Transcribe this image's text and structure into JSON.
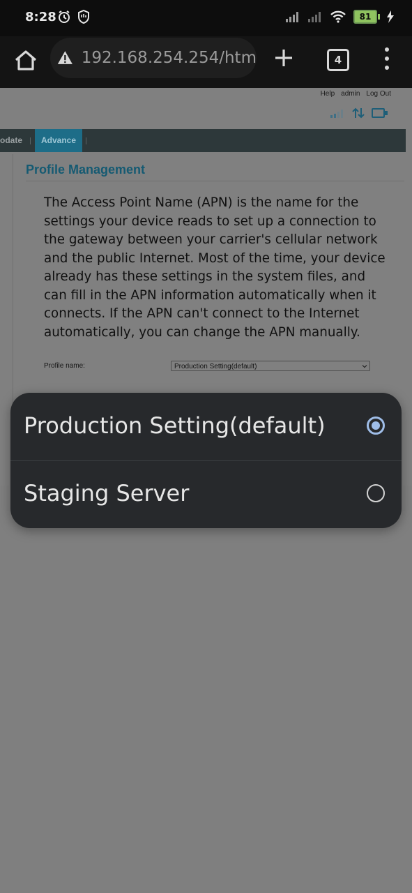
{
  "status_bar": {
    "time": "8:28",
    "battery_level": "81",
    "icons": [
      "alarm-icon",
      "shield-hand-icon",
      "signal-icon",
      "signal-icon",
      "wifi-icon",
      "battery-icon",
      "charging-icon"
    ]
  },
  "browser": {
    "url": "192.168.254.254/htm",
    "tab_count": "4",
    "icons": [
      "home-icon",
      "warning-icon",
      "plus-icon",
      "tabs-icon",
      "menu-icon"
    ]
  },
  "router_page": {
    "top_links": [
      "Help",
      "admin",
      "Log Out"
    ],
    "status_icons": [
      "signal-bars-icon",
      "data-transfer-icon",
      "device-icon"
    ],
    "nav": {
      "items": [
        "odate",
        "Advance"
      ],
      "active": "Advance"
    },
    "title": "Profile Management",
    "description": "The Access Point Name (APN) is the name for the settings your device reads to set up a connection to the gateway between your carrier's cellular network and the public Internet. Most of the time, your device already has these settings in the system files, and can fill in the APN information automatically when it connects. If the APN can't connect to the Internet automatically, you can change the APN manually.",
    "profile_label": "Profile name:",
    "profile_selected": "Production Setting(default)"
  },
  "picker": {
    "options": [
      {
        "label": "Production Setting(default)",
        "selected": true
      },
      {
        "label": "Staging Server",
        "selected": false
      }
    ]
  },
  "colors": {
    "scrim": "#7f7f7f",
    "dialog_bg": "#27292c",
    "accent_radio": "#9fbde8",
    "nav_active": "#1d6d88",
    "title": "#155a72"
  }
}
